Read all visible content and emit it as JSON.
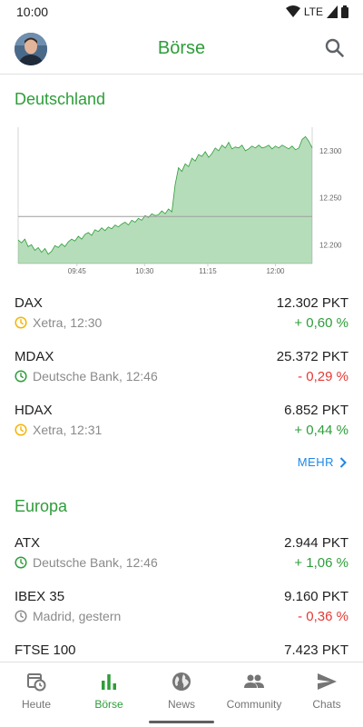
{
  "status_bar": {
    "time": "10:00",
    "network": "LTE"
  },
  "app_bar": {
    "title": "Börse"
  },
  "sections": {
    "deutschland": {
      "title": "Deutschland",
      "indices": [
        {
          "name": "DAX",
          "source": "Xetra, 12:30",
          "source_color": "#f5b400",
          "value": "12.302 PKT",
          "change": "+ 0,60 %",
          "direction": "up"
        },
        {
          "name": "MDAX",
          "source": "Deutsche Bank, 12:46",
          "source_color": "#2e9d3a",
          "value": "25.372 PKT",
          "change": "- 0,29 %",
          "direction": "down"
        },
        {
          "name": "HDAX",
          "source": "Xetra, 12:31",
          "source_color": "#f5b400",
          "value": "6.852 PKT",
          "change": "+ 0,44 %",
          "direction": "up"
        }
      ],
      "more_label": "MEHR"
    },
    "europa": {
      "title": "Europa",
      "indices": [
        {
          "name": "ATX",
          "source": "Deutsche Bank, 12:46",
          "source_color": "#2e9d3a",
          "value": "2.944 PKT",
          "change": "+ 1,06 %",
          "direction": "up"
        },
        {
          "name": "IBEX 35",
          "source": "Madrid, gestern",
          "source_color": "#8a8a8a",
          "value": "9.160 PKT",
          "change": "- 0,36 %",
          "direction": "down"
        },
        {
          "name": "FTSE 100",
          "source": "",
          "source_color": "#8a8a8a",
          "value": "7.423 PKT",
          "change": "",
          "direction": "up"
        }
      ]
    }
  },
  "chart_data": {
    "type": "area",
    "x_ticks": [
      "09:45",
      "10:30",
      "11:15",
      "12:00"
    ],
    "y_ticks": [
      "12.200",
      "12.250",
      "12.300"
    ],
    "y_tick_values": [
      12200,
      12250,
      12300
    ],
    "reference_value": 12230,
    "ylim": [
      12180,
      12325
    ],
    "series_color": "#2e9d3a",
    "values": [
      12205,
      12202,
      12206,
      12198,
      12200,
      12194,
      12197,
      12192,
      12196,
      12190,
      12193,
      12199,
      12197,
      12201,
      12198,
      12203,
      12206,
      12204,
      12209,
      12206,
      12211,
      12213,
      12210,
      12216,
      12214,
      12218,
      12215,
      12219,
      12217,
      12221,
      12219,
      12222,
      12224,
      12221,
      12226,
      12224,
      12228,
      12226,
      12231,
      12229,
      12233,
      12231,
      12232,
      12236,
      12233,
      12238,
      12235,
      12264,
      12282,
      12278,
      12286,
      12283,
      12292,
      12289,
      12296,
      12294,
      12299,
      12293,
      12297,
      12303,
      12300,
      12306,
      12303,
      12309,
      12302,
      12304,
      12303,
      12306,
      12300,
      12302,
      12305,
      12303,
      12306,
      12303,
      12304,
      12306,
      12302,
      12305,
      12303,
      12306,
      12304,
      12302,
      12305,
      12301,
      12303,
      12312,
      12315,
      12310,
      12303
    ]
  },
  "bottom_nav": {
    "items": [
      {
        "label": "Heute",
        "icon": "calendar-clock-icon",
        "active": false
      },
      {
        "label": "Börse",
        "icon": "bar-chart-icon",
        "active": true
      },
      {
        "label": "News",
        "icon": "globe-icon",
        "active": false
      },
      {
        "label": "Community",
        "icon": "people-icon",
        "active": false
      },
      {
        "label": "Chats",
        "icon": "send-icon",
        "active": false
      }
    ]
  }
}
